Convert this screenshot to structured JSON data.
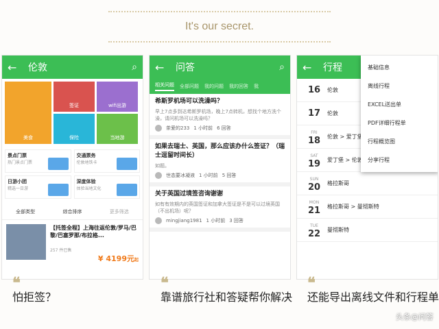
{
  "tagline": "It's our secret.",
  "watermark": "头条@问答",
  "p1": {
    "title": "伦敦",
    "tiles": [
      "美食",
      "签证",
      "wifi出游",
      "保险",
      "当地游"
    ],
    "cards": [
      {
        "t": "景点门票",
        "s": "热门景点门票"
      },
      {
        "t": "交通票务",
        "s": "伦敦地铁卡"
      },
      {
        "t": "日游小团",
        "s": "精选一日游"
      },
      {
        "t": "深度体验",
        "s": "体验当地文化"
      }
    ],
    "filters": [
      "全部类型",
      "综合排序",
      "更多筛选"
    ],
    "product": "【托签全程】上海往返伦敦/罗马/巴黎/巴塞罗那/布拉格...",
    "sold": "257 件已售",
    "price": "¥ 4199元",
    "price_suffix": "起"
  },
  "p2": {
    "title": "问答",
    "tabs": [
      "相关问题",
      "全部问题",
      "我的问题",
      "我的回答",
      "我"
    ],
    "qs": [
      {
        "h": "希斯罗机场可以洗澡吗？",
        "p": "早上7点多到达希斯罗机场，晚上7点转机，想找个地方洗个澡，请问机场可以洗澡吗？",
        "u": "茶爱的233",
        "a": "1 小时前",
        "n": "6 回答"
      },
      {
        "h": "如果去瑞士、英国，那么应该办什么签证？（瑞士逗留时间长）",
        "p": "如题。",
        "u": "世态要冰凝液",
        "a": "1 小时前",
        "n": "5 回答"
      },
      {
        "h": "关于英国过境签咨询谢谢",
        "p": "如有有效期内的英国签证和加拿大签证是不是可以过境英国（不出机场）呢？",
        "u": "mingjiang1981",
        "a": "1 小时前",
        "n": "3 回答"
      }
    ]
  },
  "p3": {
    "title": "行程",
    "rows": [
      {
        "d": "",
        "n": "16",
        "t": "伦敦"
      },
      {
        "d": "",
        "n": "17",
        "t": "伦敦"
      },
      {
        "d": "FRI",
        "n": "18",
        "t": "伦敦 > 爱丁堡"
      },
      {
        "d": "SAT",
        "n": "19",
        "t": "爱丁堡 > 伦敦"
      },
      {
        "d": "SUN",
        "n": "20",
        "t": "格拉斯哥"
      },
      {
        "d": "MON",
        "n": "21",
        "t": "格拉斯哥 > 曼彻斯特"
      },
      {
        "d": "TUE",
        "n": "22",
        "t": "曼彻斯特"
      }
    ],
    "menu": [
      "基础信息",
      "离线行程",
      "EXCEL送出单",
      "PDF详细行程单",
      "行程概览图",
      "分享行程"
    ]
  },
  "captions": [
    "怕拒签？",
    "靠谱旅行社和答疑帮你解决",
    "还能导出离线文件和行程单"
  ]
}
